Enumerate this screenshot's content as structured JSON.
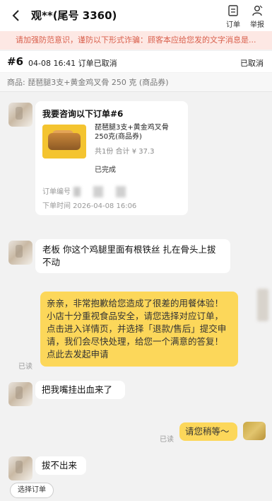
{
  "header": {
    "title": "观**(尾号 3360)",
    "orders_label": "订单",
    "report_label": "举报"
  },
  "notice": "请加强防范意识，谨防以下形式诈骗：顾客本应给您发的文字消息是...",
  "order": {
    "number": "#6",
    "time_status": "04-08 16:41  订单已取消",
    "status_right": "已取消",
    "product_line": "商品: 琵琶腿3支+黄金鸡叉骨 250 克 (商品券)"
  },
  "card": {
    "title": "我要咨询以下订单#6",
    "product": "琵琶腿3支+黄金鸡叉骨 250克(商品券)",
    "meta": "共1份 合计 ¥ 37.3",
    "state": "已完成",
    "order_no_label": "订单编号",
    "order_time": "下单时间   2026-04-08 16:06"
  },
  "messages": [
    {
      "text": "老板 你这个鸡腿里面有根铁丝 扎在骨头上拔不动"
    },
    {
      "text": "亲亲，非常抱歉给您造成了很差的用餐体验！小店十分重视食品安全，请您选择对应订单，点击进入详情页，并选择「退款/售后」提交申请，我们会尽快处理，给您一个满意的答复！点此去发起申请",
      "read": "已读"
    },
    {
      "text": "把我嘴挂出血来了"
    },
    {
      "text": "请您稍等～",
      "read": "已读"
    },
    {
      "text": "拔不出来"
    }
  ],
  "select_order_label": "选择订单",
  "colors": {
    "merchant_bubble": "#fcd75a",
    "notice_bg": "#fde8e4",
    "notice_text": "#d9604d"
  }
}
